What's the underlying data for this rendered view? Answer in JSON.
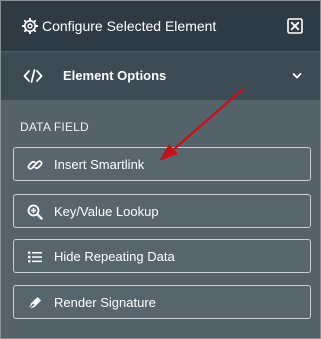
{
  "header": {
    "title": "Configure Selected Element",
    "icon": "gear-icon",
    "close_icon": "close-icon"
  },
  "element_options": {
    "label": "Element Options",
    "icon": "code-icon",
    "chevron_icon": "chevron-down-icon"
  },
  "data_field": {
    "section_label": "DATA FIELD",
    "buttons": [
      {
        "label": "Insert Smartlink",
        "icon": "link-icon"
      },
      {
        "label": "Key/Value Lookup",
        "icon": "zoom-in-icon"
      },
      {
        "label": "Hide Repeating Data",
        "icon": "list-icon"
      },
      {
        "label": "Render Signature",
        "icon": "pen-icon"
      }
    ]
  },
  "colors": {
    "header_bg": "#2f3b44",
    "options_bg": "#3b4a53",
    "panel_bg": "#55626a",
    "annotation_arrow": "#c0141a"
  }
}
